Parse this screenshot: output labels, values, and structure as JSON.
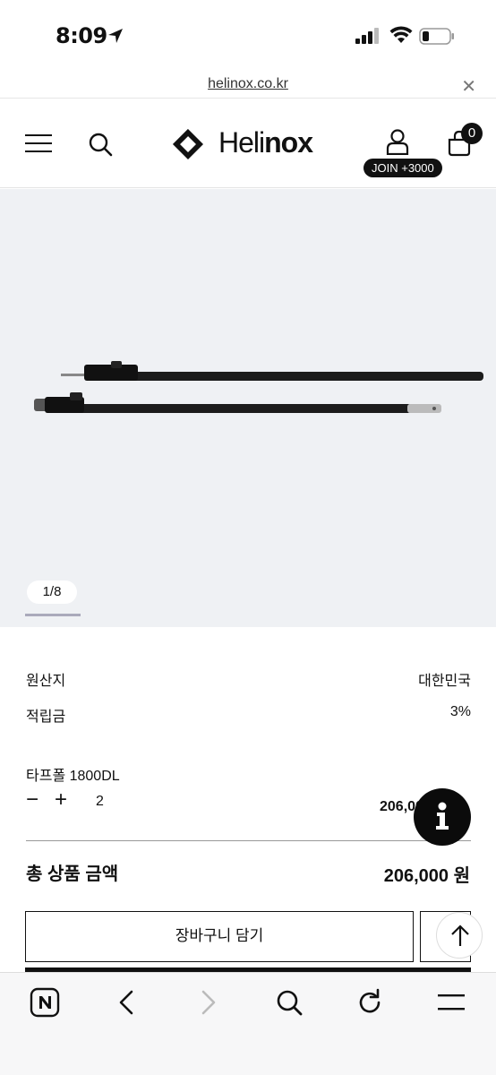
{
  "status_bar": {
    "time": "8:09"
  },
  "browser": {
    "url": "helinox.co.kr"
  },
  "header": {
    "logo_light": "Heli",
    "logo_bold": "nox",
    "join_badge": "JOIN +3000",
    "cart_count": "0"
  },
  "gallery": {
    "pager": "1/8"
  },
  "info": {
    "origin_label": "원산지",
    "origin_value": "대한민국",
    "points_label": "적립금",
    "points_value": "3%"
  },
  "option": {
    "name": "타프폴 1800DL",
    "minus": "−",
    "plus": "+",
    "quantity": "2",
    "line_price": "206,000 원"
  },
  "total": {
    "label": "총 상품 금액",
    "value": "206,000 원"
  },
  "actions": {
    "add_to_cart": "장바구니 담기"
  },
  "colors": {
    "accent": "#111111",
    "gallery_bg": "#eff1f4"
  }
}
